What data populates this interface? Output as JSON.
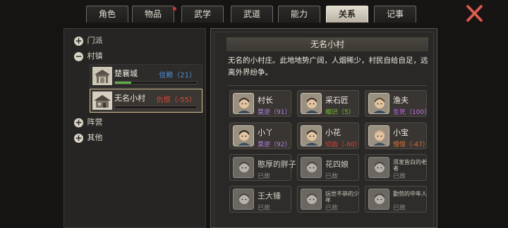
{
  "tabs": [
    {
      "label": "角色",
      "active": false
    },
    {
      "label": "物品",
      "active": false
    },
    {
      "label": "武学",
      "active": false
    },
    {
      "label": "武道",
      "active": false
    },
    {
      "label": "能力",
      "active": false
    },
    {
      "label": "关系",
      "active": true
    },
    {
      "label": "记事",
      "active": false
    }
  ],
  "tree": {
    "sect": {
      "label": "门派",
      "toggle": "+"
    },
    "town": {
      "label": "村镇",
      "toggle": "−"
    },
    "camp": {
      "label": "阵营",
      "toggle": "+"
    },
    "other": {
      "label": "其他",
      "toggle": "+"
    }
  },
  "places": [
    {
      "name": "楚襄城",
      "relation": "信赖（21）",
      "relation_color": "#4d8fd6",
      "bar_fraction": 0.2,
      "bar_color": "#5fae4c"
    },
    {
      "name": "无名小村",
      "relation": "仇恨（-55）",
      "relation_color": "#d9473b",
      "bar_fraction": 0.0,
      "bar_color": "#c9473b"
    }
  ],
  "detail": {
    "title": "无名小村",
    "description": "无名的小村庄。此地地势广阔，人烟稀少，村民自给自足，远离外界纷争。"
  },
  "npcs": [
    {
      "name": "村长",
      "relation": "莫逆（91）",
      "color": "#b480e0",
      "dead": false
    },
    {
      "name": "采石匠",
      "relation": "相识（5）",
      "color": "#7fbf3a",
      "dead": false
    },
    {
      "name": "渔夫",
      "relation": "生死（100）",
      "color": "#c06de8",
      "dead": false
    },
    {
      "name": "小丫",
      "relation": "莫逆（92）",
      "color": "#b480e0",
      "dead": false
    },
    {
      "name": "小花",
      "relation": "切齿（-60）",
      "color": "#d9473b",
      "dead": false
    },
    {
      "name": "小宝",
      "relation": "憎恨（-47）",
      "color": "#d9743b",
      "dead": false
    },
    {
      "name": "憨厚的胖子",
      "relation": "已故",
      "color": "#8e8a83",
      "dead": true
    },
    {
      "name": "花四娘",
      "relation": "已故",
      "color": "#8e8a83",
      "dead": true
    },
    {
      "name": "须发皆白的老者",
      "relation": "已故",
      "color": "#8e8a83",
      "dead": true
    },
    {
      "name": "王大锤",
      "relation": "已故",
      "color": "#8e8a83",
      "dead": true
    },
    {
      "name": "玩世不恭的少年",
      "relation": "已故",
      "color": "#8e8a83",
      "dead": true
    },
    {
      "name": "勤劳的中年人",
      "relation": "已故",
      "color": "#8e8a83",
      "dead": true
    }
  ],
  "icons": {
    "close": "close-x-icon",
    "place": "village-gate-icon",
    "portrait": "character-portrait-icon"
  },
  "colors": {
    "close_red": "#c94a3c",
    "active_tab": "#d6cfc0"
  }
}
